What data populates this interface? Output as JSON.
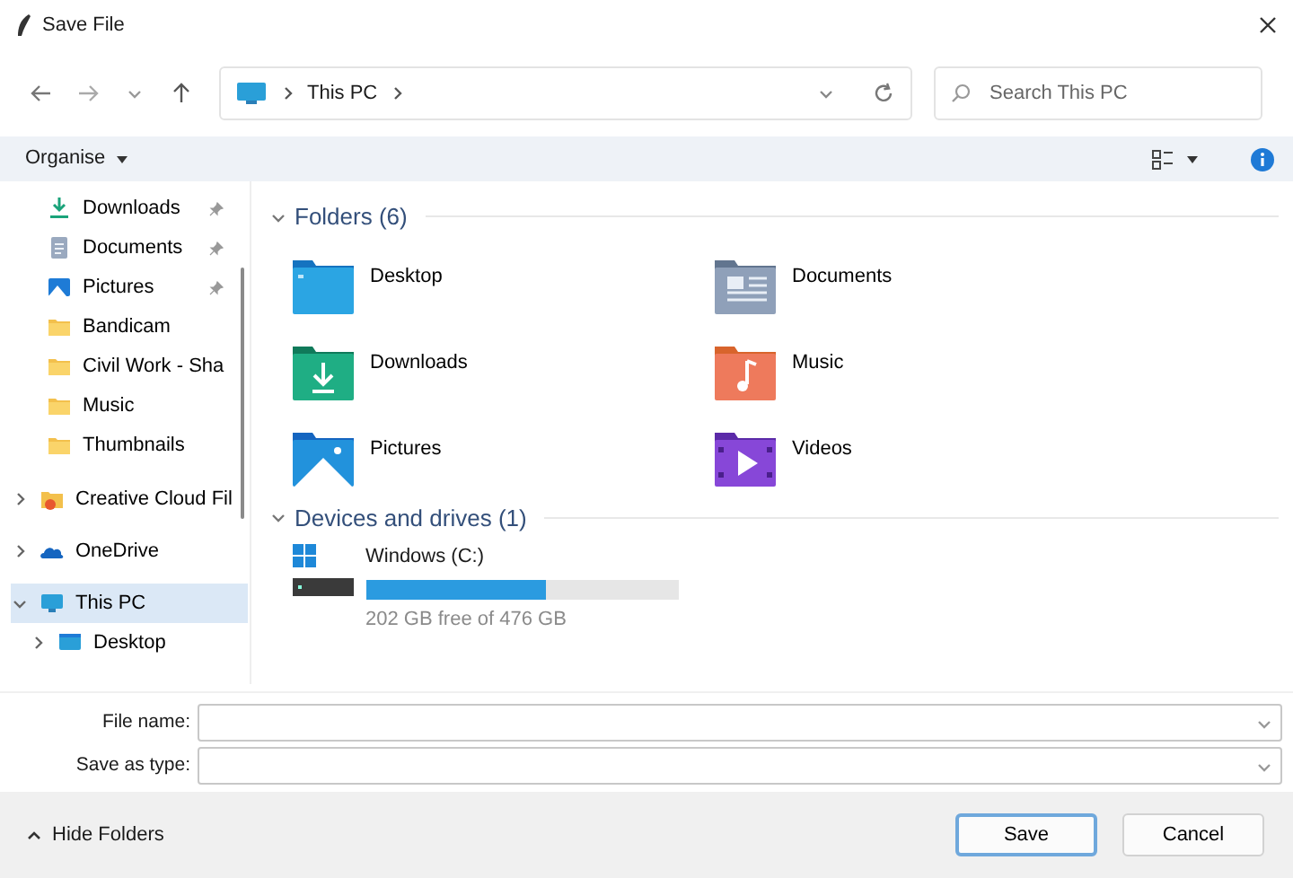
{
  "window": {
    "title": "Save File"
  },
  "address_bar": {
    "location": "This PC"
  },
  "search": {
    "placeholder": "Search This PC"
  },
  "command_bar": {
    "organise": "Organise"
  },
  "sidebar": {
    "items": [
      {
        "label": "Downloads",
        "kind": "downloads",
        "pinned": true
      },
      {
        "label": "Documents",
        "kind": "documents",
        "pinned": true
      },
      {
        "label": "Pictures",
        "kind": "pictures",
        "pinned": true
      },
      {
        "label": "Bandicam",
        "kind": "folder",
        "pinned": false
      },
      {
        "label": "Civil Work - Sha",
        "kind": "folder",
        "pinned": false
      },
      {
        "label": "Music",
        "kind": "folder",
        "pinned": false
      },
      {
        "label": "Thumbnails",
        "kind": "folder",
        "pinned": false
      },
      {
        "label": "Creative Cloud Fil",
        "kind": "cloud-files",
        "expanded": false,
        "selected": false
      },
      {
        "label": "OneDrive",
        "kind": "onedrive",
        "expanded": false,
        "selected": false
      },
      {
        "label": "This PC",
        "kind": "pc",
        "expanded": true,
        "selected": true,
        "children": [
          {
            "label": "Desktop",
            "kind": "desktop",
            "expanded": false,
            "selected": false
          }
        ]
      }
    ]
  },
  "sections": [
    {
      "title": "Folders (6)",
      "expanded": true,
      "folders": [
        {
          "label": "Desktop",
          "kind": "desktop"
        },
        {
          "label": "Documents",
          "kind": "documents"
        },
        {
          "label": "Downloads",
          "kind": "downloads"
        },
        {
          "label": "Music",
          "kind": "music"
        },
        {
          "label": "Pictures",
          "kind": "pictures"
        },
        {
          "label": "Videos",
          "kind": "videos"
        }
      ]
    },
    {
      "title": "Devices and drives (1)",
      "expanded": true,
      "drives": [
        {
          "label": "Windows (C:)",
          "level": 0.576,
          "free": "202 GB free of 476 GB"
        }
      ]
    }
  ],
  "form": {
    "fields": [
      {
        "label": "File name:"
      },
      {
        "label": "Save as type:"
      }
    ]
  },
  "footer": {
    "toggle": "Hide Folders",
    "buttons": [
      {
        "label": "Save",
        "selected": true
      },
      {
        "label": "Cancel",
        "selected": false
      }
    ]
  }
}
